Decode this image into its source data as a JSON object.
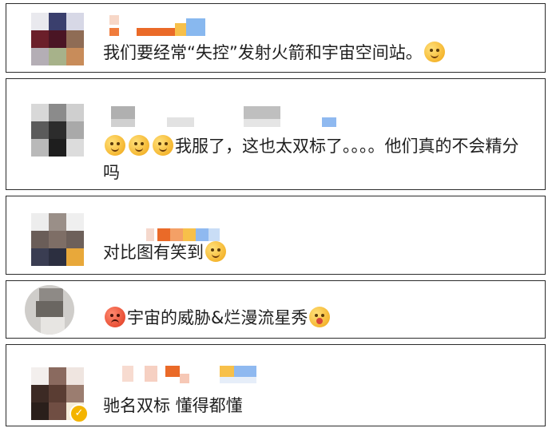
{
  "comments": [
    {
      "text_before": "我们要经常“失控”发射火箭和宇宙空间站。",
      "emojis_after": [
        "shy-blush-emoji"
      ]
    },
    {
      "emojis_before": [
        "laugh-cry-emoji",
        "laugh-cry-emoji",
        "laugh-cry-emoji"
      ],
      "text_before": "我服了，这也太双标了。。。。他们真的不会精分吗"
    },
    {
      "text_before": "对比图有笑到",
      "emojis_after": [
        "yummy-emoji"
      ]
    },
    {
      "emojis_before": [
        "angry-emoji"
      ],
      "text_before": "宇宙的威胁&烂漫流星秀",
      "emojis_after": [
        "hungry-emoji"
      ]
    },
    {
      "text_before": "驰名双标 懂得都懂",
      "verified_badge": "✓"
    }
  ]
}
